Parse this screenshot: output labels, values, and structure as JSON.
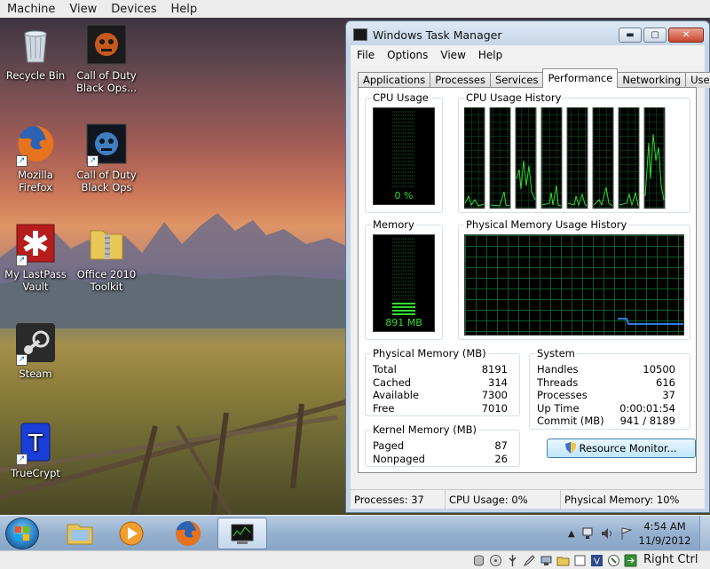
{
  "vm_menu": [
    "Machine",
    "View",
    "Devices",
    "Help"
  ],
  "desktop_icons": [
    {
      "label": "Recycle Bin",
      "icon": "recycle-bin-icon"
    },
    {
      "label": "Call of Duty Black Ops...",
      "icon": "call-of-duty-icon"
    },
    {
      "label": "Mozilla Firefox",
      "icon": "firefox-icon"
    },
    {
      "label": "Call of Duty Black Ops",
      "icon": "call-of-duty-icon"
    },
    {
      "label": "My LastPass Vault",
      "icon": "lastpass-icon"
    },
    {
      "label": "Office 2010 Toolkit",
      "icon": "zip-folder-icon"
    },
    {
      "label": "Steam",
      "icon": "steam-icon"
    },
    {
      "label": "TrueCrypt",
      "icon": "truecrypt-icon"
    }
  ],
  "task_manager": {
    "title": "Windows Task Manager",
    "menu": [
      "File",
      "Options",
      "View",
      "Help"
    ],
    "tabs": [
      "Applications",
      "Processes",
      "Services",
      "Performance",
      "Networking",
      "Users"
    ],
    "active_tab": "Performance",
    "cpu_usage": {
      "label": "CPU Usage",
      "value": "0 %",
      "level": 0.0
    },
    "cpu_history": {
      "label": "CPU Usage History"
    },
    "memory": {
      "label": "Memory",
      "value": "891 MB",
      "level": 0.11
    },
    "memory_history": {
      "label": "Physical Memory Usage History"
    },
    "physical_memory": {
      "label": "Physical Memory (MB)",
      "rows": [
        {
          "name": "Total",
          "value": "8191"
        },
        {
          "name": "Cached",
          "value": "314"
        },
        {
          "name": "Available",
          "value": "7300"
        },
        {
          "name": "Free",
          "value": "7010"
        }
      ]
    },
    "kernel_memory": {
      "label": "Kernel Memory (MB)",
      "rows": [
        {
          "name": "Paged",
          "value": "87"
        },
        {
          "name": "Nonpaged",
          "value": "26"
        }
      ]
    },
    "system": {
      "label": "System",
      "rows": [
        {
          "name": "Handles",
          "value": "10500"
        },
        {
          "name": "Threads",
          "value": "616"
        },
        {
          "name": "Processes",
          "value": "37"
        },
        {
          "name": "Up Time",
          "value": "0:00:01:54"
        },
        {
          "name": "Commit (MB)",
          "value": "941 / 8189"
        }
      ]
    },
    "resource_monitor_label": "Resource Monitor...",
    "status": {
      "processes": "Processes: 37",
      "cpu": "CPU Usage: 0%",
      "memory": "Physical Memory: 10%"
    },
    "window_controls": {
      "minimize": "▬",
      "maximize": "▢",
      "close": "✕"
    }
  },
  "taskbar": {
    "items": [
      "windows-explorer-icon",
      "media-player-icon",
      "firefox-icon",
      "task-manager-icon"
    ],
    "clock_time": "4:54 AM",
    "clock_date": "11/9/2012"
  },
  "vm_status": {
    "host_key": "Right Ctrl"
  },
  "colors": {
    "graph_green": "#2fe02f",
    "graph_grid": "#0c5a28",
    "memory_line": "#2f7be0"
  }
}
